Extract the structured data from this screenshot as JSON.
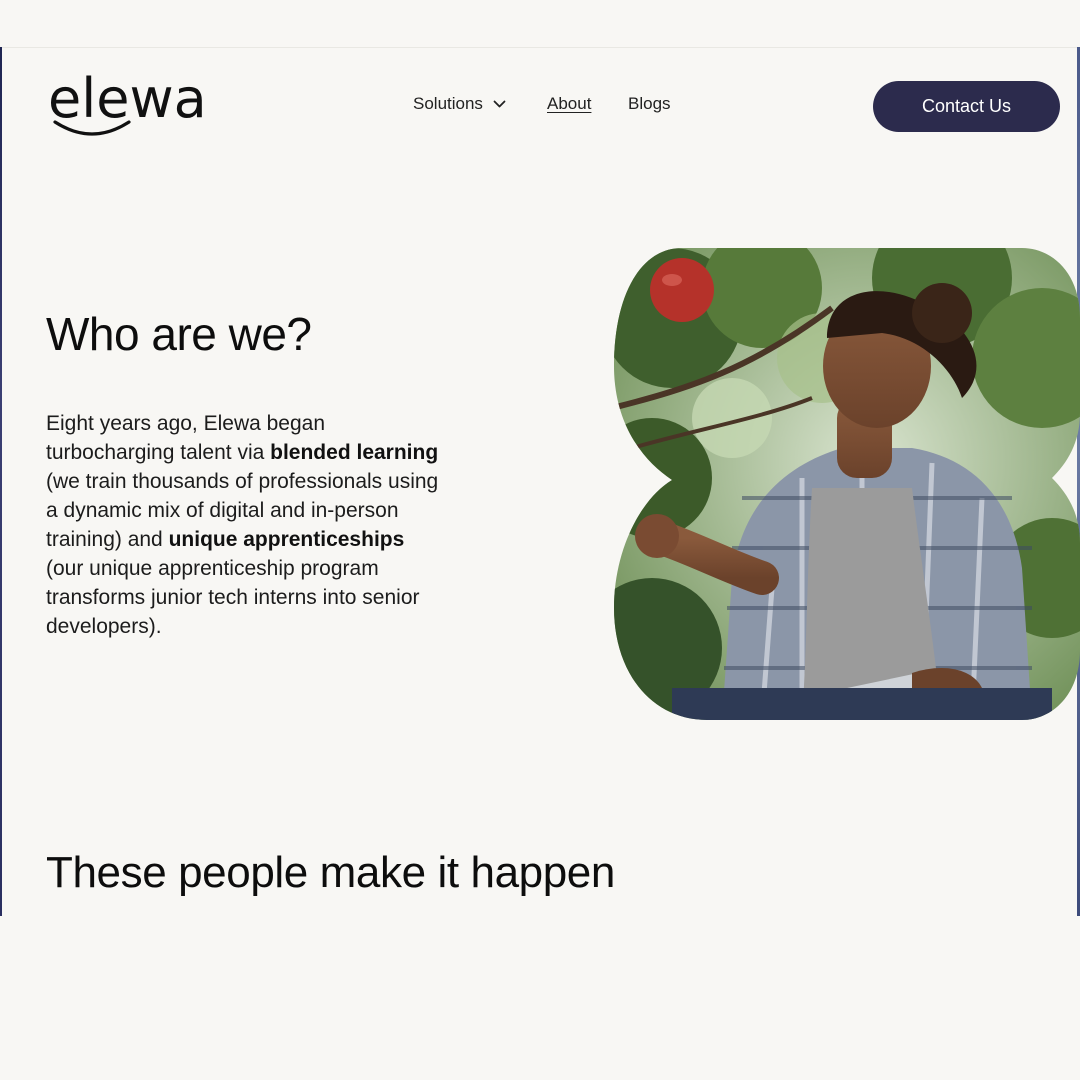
{
  "header": {
    "logo_text": "elewa",
    "nav": {
      "solutions": "Solutions",
      "about": "About",
      "blogs": "Blogs"
    },
    "contact_button": "Contact Us"
  },
  "hero": {
    "title": "Who are we?",
    "body": {
      "part1": "Eight years ago, Elewa began turbocharging talent via ",
      "bold1": "blended learning",
      "part2": " (we train thousands of professionals using a dynamic mix of digital and in-person training) and ",
      "bold2": "unique apprenticeships",
      "part3": " (our unique apprenticeship program transforms junior tech interns into senior developers)."
    }
  },
  "team_section": {
    "title": "These people make it happen"
  },
  "colors": {
    "background": "#f8f7f4",
    "button": "#2c2b4d",
    "text": "#111111"
  },
  "icons": {
    "nav_dropdown": "chevron-down-icon",
    "logo_mark": "smile-icon"
  }
}
